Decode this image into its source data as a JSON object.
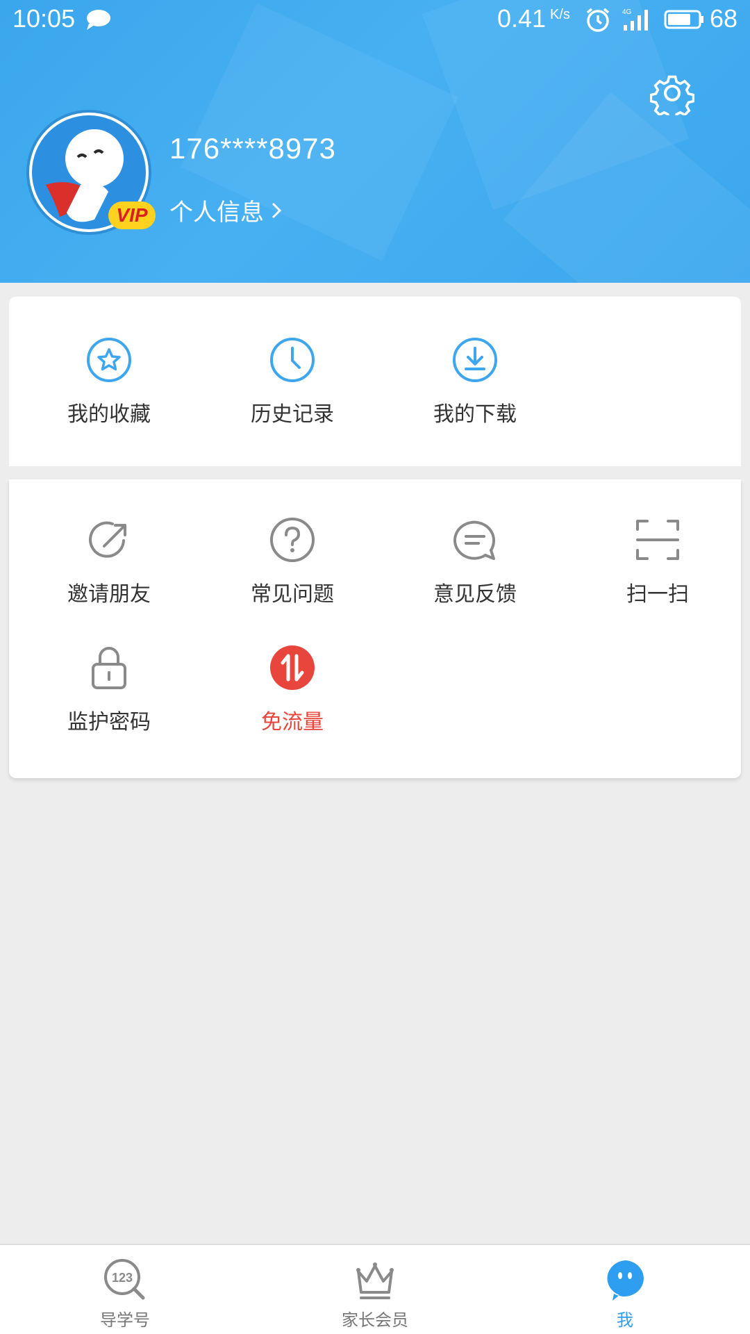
{
  "status_bar": {
    "time": "10:05",
    "speed": "0.41",
    "speed_unit": "K/s",
    "network": "4G",
    "battery": "68"
  },
  "profile": {
    "phone": "176****8973",
    "info_link": "个人信息",
    "badge": "VIP"
  },
  "quick_actions": [
    {
      "label": "我的收藏",
      "icon": "star-icon"
    },
    {
      "label": "历史记录",
      "icon": "clock-icon"
    },
    {
      "label": "我的下载",
      "icon": "download-icon"
    }
  ],
  "tools": [
    {
      "label": "邀请朋友",
      "icon": "share-icon"
    },
    {
      "label": "常见问题",
      "icon": "question-icon"
    },
    {
      "label": "意见反馈",
      "icon": "feedback-icon"
    },
    {
      "label": "扫一扫",
      "icon": "scan-icon"
    },
    {
      "label": "监护密码",
      "icon": "lock-icon"
    },
    {
      "label": "免流量",
      "icon": "data-free-icon"
    }
  ],
  "tabs": [
    {
      "label": "导学号",
      "icon": "search-123-icon",
      "active": false
    },
    {
      "label": "家长会员",
      "icon": "crown-icon",
      "active": false
    },
    {
      "label": "我",
      "icon": "profile-icon",
      "active": true
    }
  ],
  "colors": {
    "header_blue": "#3ca7ee",
    "icon_blue": "#3ea6ee",
    "icon_gray": "#8a8a8a",
    "accent_red": "#e8453c",
    "tab_active": "#2e9ef0"
  }
}
